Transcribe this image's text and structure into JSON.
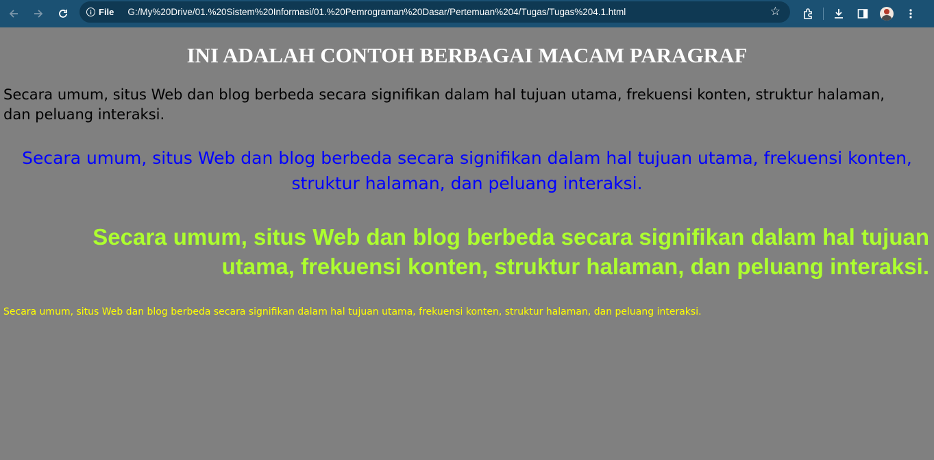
{
  "browser": {
    "site_chip_label": "File",
    "url": "G:/My%20Drive/01.%20Sistem%20Informasi/01.%20Pemrograman%20Dasar/Pertemuan%204/Tugas/Tugas%204.1.html",
    "toolbar_color": "#1b5173",
    "icons": [
      "back-icon",
      "forward-icon",
      "reload-icon",
      "info-icon",
      "star-icon",
      "extensions-icon",
      "download-icon",
      "side-panel-icon",
      "avatar",
      "menu-icon"
    ]
  },
  "page": {
    "background_color": "#808080",
    "heading": "INI ADALAH CONTOH BERBAGAI MACAM PARAGRAF",
    "paragraphs": [
      {
        "text": "Secara umum, situs Web dan blog berbeda secara signifikan dalam hal tujuan utama, frekuensi konten, struktur halaman, dan peluang interaksi.",
        "color": "#000000",
        "align": "left"
      },
      {
        "text": "Secara umum, situs Web dan blog berbeda secara signifikan dalam hal tujuan utama, frekuensi konten, struktur halaman, dan peluang interaksi.",
        "color": "#0000ff",
        "align": "center"
      },
      {
        "text": "Secara umum, situs Web dan blog berbeda secara signifikan dalam hal tujuan utama, frekuensi konten, struktur halaman, dan peluang interaksi.",
        "color": "#adff2f",
        "align": "right"
      },
      {
        "text": "Secara umum, situs Web dan blog berbeda secara signifikan dalam hal tujuan utama, frekuensi konten, struktur halaman, dan peluang interaksi.",
        "color": "#ffff00",
        "align": "left"
      }
    ]
  }
}
